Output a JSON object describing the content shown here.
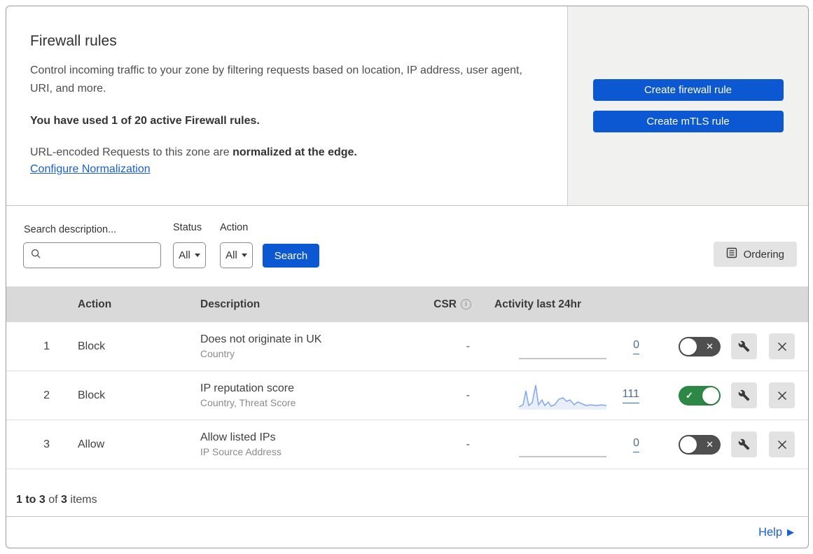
{
  "header": {
    "title": "Firewall rules",
    "description": "Control incoming traffic to your zone by filtering requests based on location, IP address, user agent, URI, and more.",
    "usage_text": "You have used 1 of 20 active Firewall rules.",
    "normalization_prefix": "URL-encoded Requests to this zone are ",
    "normalization_bold": "normalized at the edge.",
    "normalization_link": "Configure Normalization",
    "create_firewall_button": "Create firewall rule",
    "create_mtls_button": "Create mTLS rule"
  },
  "filters": {
    "search_label": "Search description...",
    "status_label": "Status",
    "status_value": "All",
    "action_label": "Action",
    "action_value": "All",
    "search_button": "Search",
    "ordering_button": "Ordering"
  },
  "table": {
    "columns": {
      "action": "Action",
      "description": "Description",
      "csr": "CSR",
      "activity": "Activity last 24hr"
    },
    "rows": [
      {
        "priority": "1",
        "action": "Block",
        "description": "Does not originate in UK",
        "criteria": "Country",
        "csr": "-",
        "activity_count": "0",
        "enabled": false,
        "sparkline": []
      },
      {
        "priority": "2",
        "action": "Block",
        "description": "IP reputation score",
        "criteria": "Country, Threat Score",
        "csr": "-",
        "activity_count": "111",
        "enabled": true,
        "sparkline": [
          [
            0,
            36
          ],
          [
            6,
            33
          ],
          [
            10,
            13
          ],
          [
            14,
            34
          ],
          [
            19,
            30
          ],
          [
            24,
            5
          ],
          [
            28,
            33
          ],
          [
            33,
            26
          ],
          [
            37,
            34
          ],
          [
            42,
            29
          ],
          [
            46,
            35
          ],
          [
            51,
            33
          ],
          [
            57,
            25
          ],
          [
            63,
            23
          ],
          [
            68,
            28
          ],
          [
            73,
            26
          ],
          [
            79,
            33
          ],
          [
            84,
            29
          ],
          [
            89,
            31
          ],
          [
            96,
            34
          ],
          [
            103,
            33
          ],
          [
            111,
            34
          ],
          [
            118,
            33
          ],
          [
            125,
            34
          ]
        ]
      },
      {
        "priority": "3",
        "action": "Allow",
        "description": "Allow listed IPs",
        "criteria": "IP Source Address",
        "csr": "-",
        "activity_count": "0",
        "enabled": false,
        "sparkline": []
      }
    ]
  },
  "footer": {
    "pagination": {
      "range": "1 to 3",
      "of": "of",
      "total": "3",
      "items": "items"
    },
    "help_label": "Help"
  },
  "icons": {
    "search": "magnifier",
    "chevron_down": "filled triangle",
    "ordering": "list document",
    "info": "circled i",
    "wrench": "spanner",
    "close": "x cross",
    "toggle_on": "checkmark",
    "toggle_off": "x cross",
    "help_arrow": "right triangle"
  },
  "colors": {
    "accent_blue": "#0b58d2",
    "link_blue": "#1a5fd0",
    "toggle_on_green": "#2d8745",
    "toggle_off_gray": "#4f4f4f",
    "sparkline_blue": "#7fa8e8",
    "panel_gray": "#f1f1f0",
    "table_header_gray": "#d9d9d9"
  }
}
